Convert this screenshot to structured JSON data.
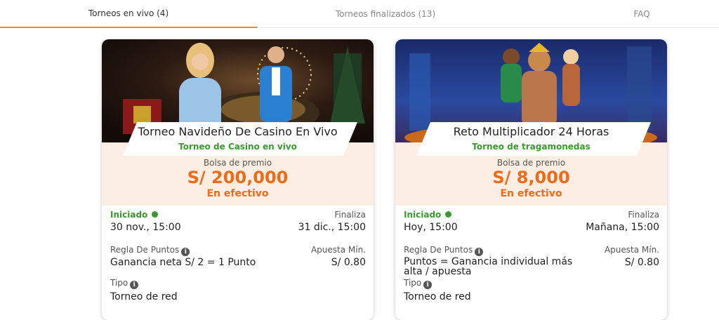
{
  "tabs": [
    {
      "label": "Torneos en vivo (4)"
    },
    {
      "label": "Torneos finalizados (13)"
    },
    {
      "label": "FAQ"
    }
  ],
  "accent_color": "#f06b17",
  "cards": [
    {
      "title": "Torneo Navideño De Casino En Vivo",
      "subtitle": "Torneo de Casino en vivo",
      "prize_label": "Bolsa de premio",
      "prize_value": "S/ 200,000",
      "prize_type": "En efectivo",
      "status": "Iniciado",
      "start_value": "30 nov., 15:00",
      "end_label": "Finaliza",
      "end_value": "31 dic., 15:00",
      "rule_label": "Regla De Puntos",
      "rule_value": "Ganancia neta S/ 2 = 1 Punto",
      "min_bet_label": "Apuesta Mín.",
      "min_bet_value": "S/ 0.80",
      "type_label": "Tipo",
      "type_value": "Torneo de red"
    },
    {
      "title": "Reto Multiplicador 24 Horas",
      "subtitle": "Torneo de tragamonedas",
      "prize_label": "Bolsa de premio",
      "prize_value": "S/ 8,000",
      "prize_type": "En efectivo",
      "status": "Iniciado",
      "start_value": "Hoy, 15:00",
      "end_label": "Finaliza",
      "end_value": "Mañana, 15:00",
      "rule_label": "Regla De Puntos",
      "rule_value": "Puntos = Ganancia individual más alta / apuesta",
      "min_bet_label": "Apuesta Mín.",
      "min_bet_value": "S/ 0.80",
      "type_label": "Tipo",
      "type_value": "Torneo de red"
    }
  ]
}
